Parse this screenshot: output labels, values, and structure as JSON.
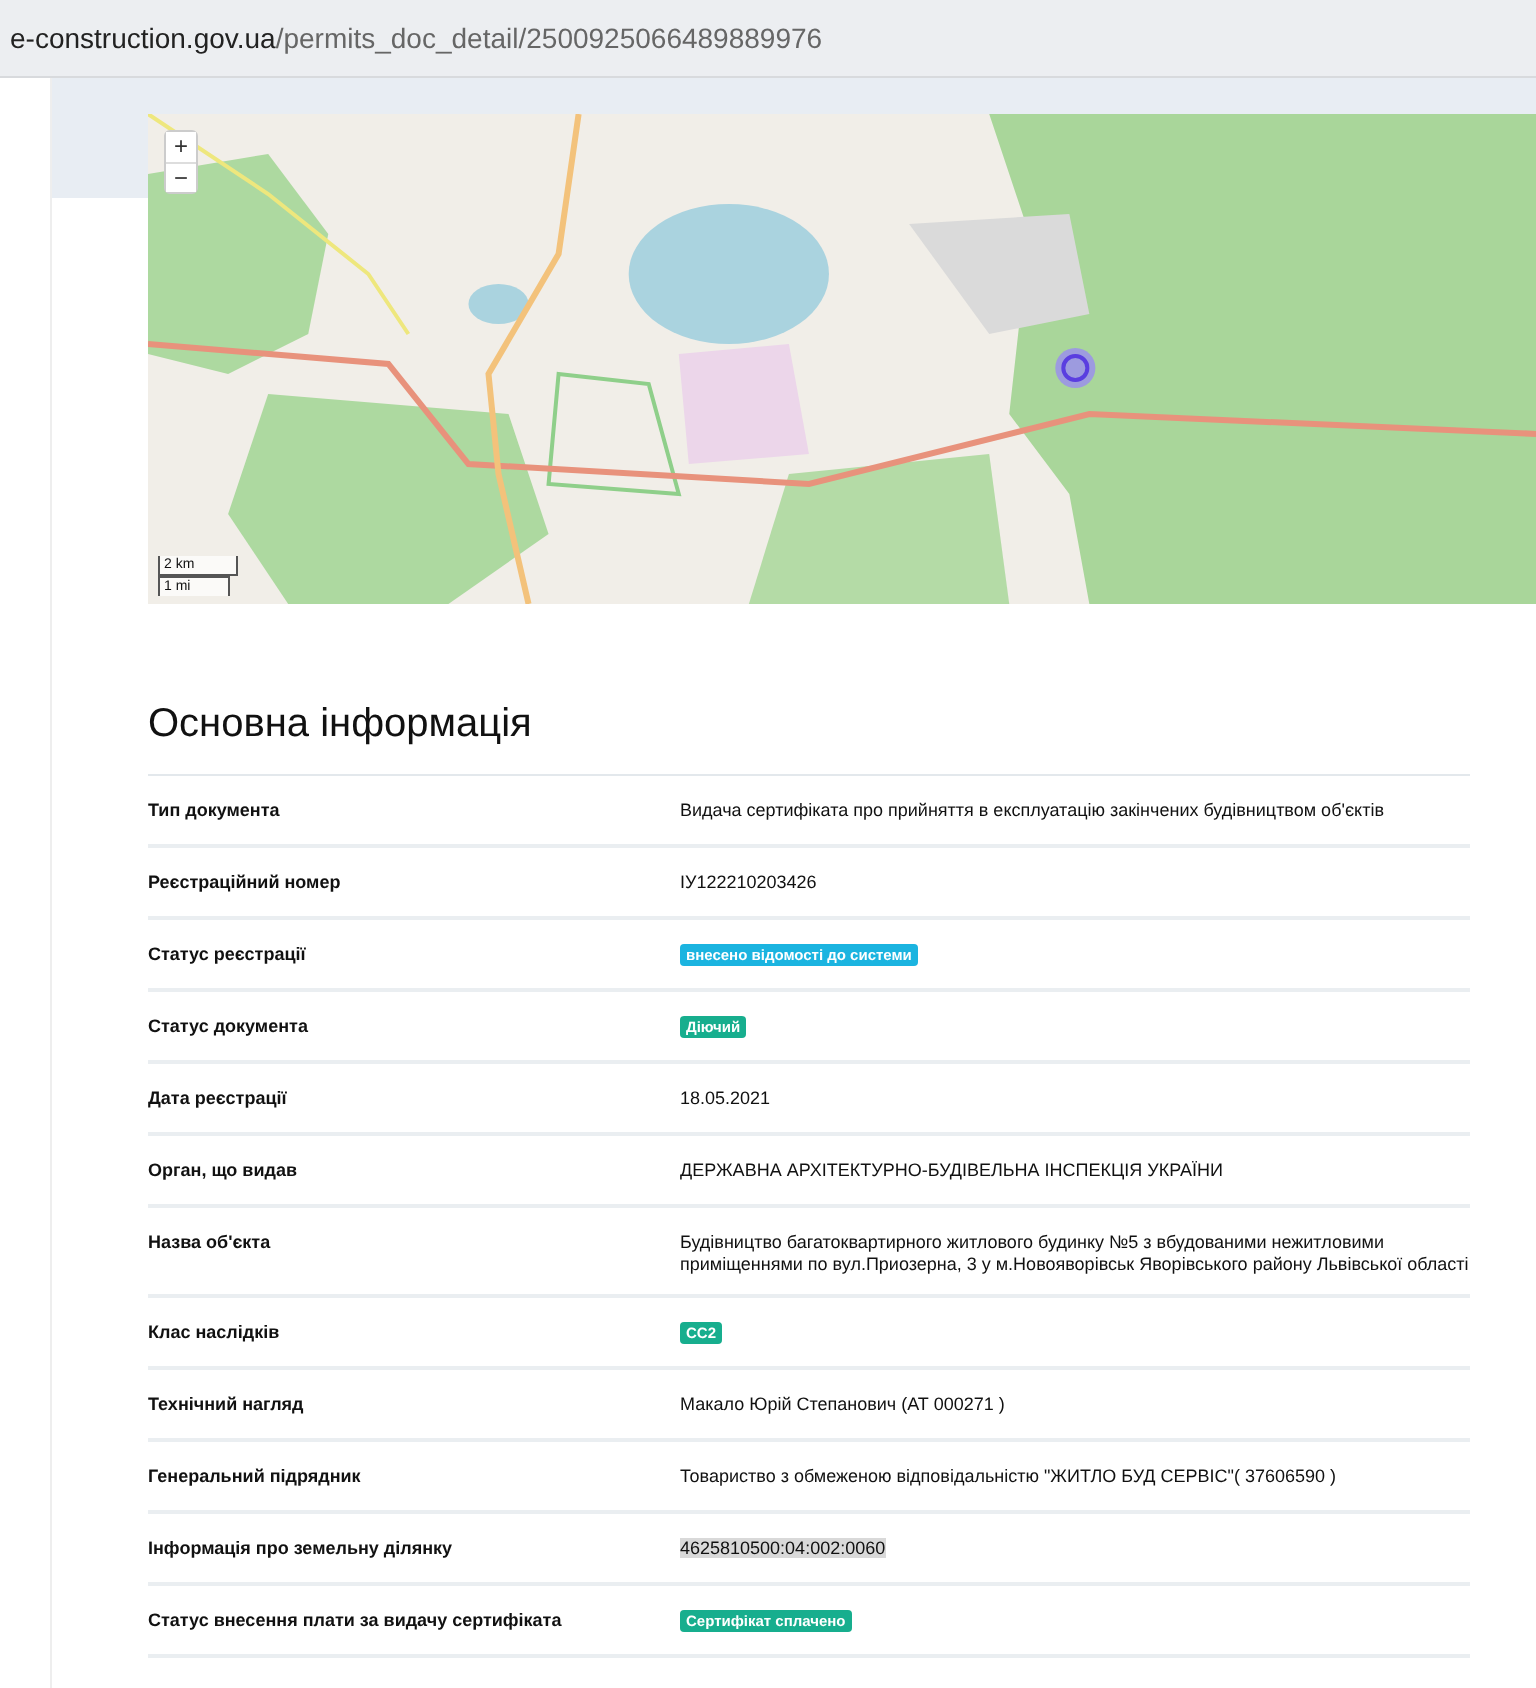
{
  "address_bar": {
    "domain": "e-construction.gov.ua",
    "path": "/permits_doc_detail/2500925066489889976"
  },
  "map": {
    "zoom_in": "+",
    "zoom_out": "−",
    "scale": [
      "2 km",
      "1 mi"
    ]
  },
  "section": {
    "title": "Основна інформація",
    "rows": [
      {
        "label": "Тип документа",
        "kind": "text",
        "value": "Видача сертифіката про прийняття в експлуатацію закінчених будівництвом об'єктів"
      },
      {
        "label": "Реєстраційний номер",
        "kind": "text",
        "value": "ІУ122210203426"
      },
      {
        "label": "Статус реєстрації",
        "kind": "badge",
        "value": "внесено відомості до системи",
        "color": "#1bb4e0"
      },
      {
        "label": "Статус документа",
        "kind": "badge",
        "value": "Діючий",
        "color": "#17ae8e"
      },
      {
        "label": "Дата реєстрації",
        "kind": "text",
        "value": "18.05.2021"
      },
      {
        "label": "Орган, що видав",
        "kind": "text",
        "value": "ДЕРЖАВНА АРХІТЕКТУРНО-БУДІВЕЛЬНА ІНСПЕКЦІЯ УКРАЇНИ"
      },
      {
        "label": "Назва об'єкта",
        "kind": "text",
        "value": "Будівництво багатоквартирного житлового будинку №5 з вбудованими нежитловими приміщеннями по вул.Приозерна, 3 у м.Новояворівськ Яворівського району Львівської області"
      },
      {
        "label": "Клас наслідків",
        "kind": "badge",
        "value": "СС2",
        "color": "#17ae8e"
      },
      {
        "label": "Технічний нагляд",
        "kind": "text",
        "value": "Макало Юрій Степанович (АТ 000271 )"
      },
      {
        "label": "Генеральний підрядник",
        "kind": "text",
        "value": "Товариство з обмеженою відповідальністю \"ЖИТЛО БУД СЕРВІС\"( 37606590 )"
      },
      {
        "label": "Інформація про земельну ділянку",
        "kind": "highlight",
        "value": "4625810500:04:002:0060"
      },
      {
        "label": "Статус внесення плати за видачу сертифіката",
        "kind": "badge",
        "value": "Сертифікат сплачено",
        "color": "#17ae8e"
      }
    ]
  }
}
